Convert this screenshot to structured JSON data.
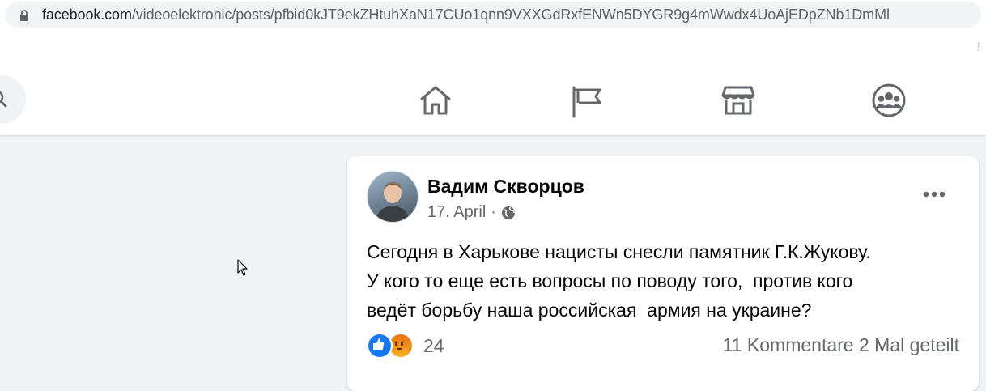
{
  "browser": {
    "url_host": "facebook.com",
    "url_path": "/videoelektronic/posts/pfbid0kJT9ekZHtuhXaN17CUo1qnn9VXXGdRxfENWn5DYGR9g4mWwdx4UoAjEDpZNb1DmMl"
  },
  "nav": {
    "icons": [
      "home-icon",
      "pages-flag-icon",
      "marketplace-icon",
      "groups-icon"
    ]
  },
  "post": {
    "author": "Вадим Скворцов",
    "date": "17. April",
    "date_separator": "·",
    "text_lines": [
      "Сегодня в Харькове нацисты снесли памятник Г.К.Жукову.",
      "У кого то еще есть вопросы по поводу того,  против кого",
      "ведёт борьбу наша российская  армия на украине?"
    ],
    "reaction_count": "24",
    "comments": "11 Kommentare",
    "shares": "2 Mal geteilt"
  },
  "colors": {
    "facebook_blue": "#1877f2",
    "icon_gray": "#65676b",
    "page_bg": "#f0f2f5"
  }
}
